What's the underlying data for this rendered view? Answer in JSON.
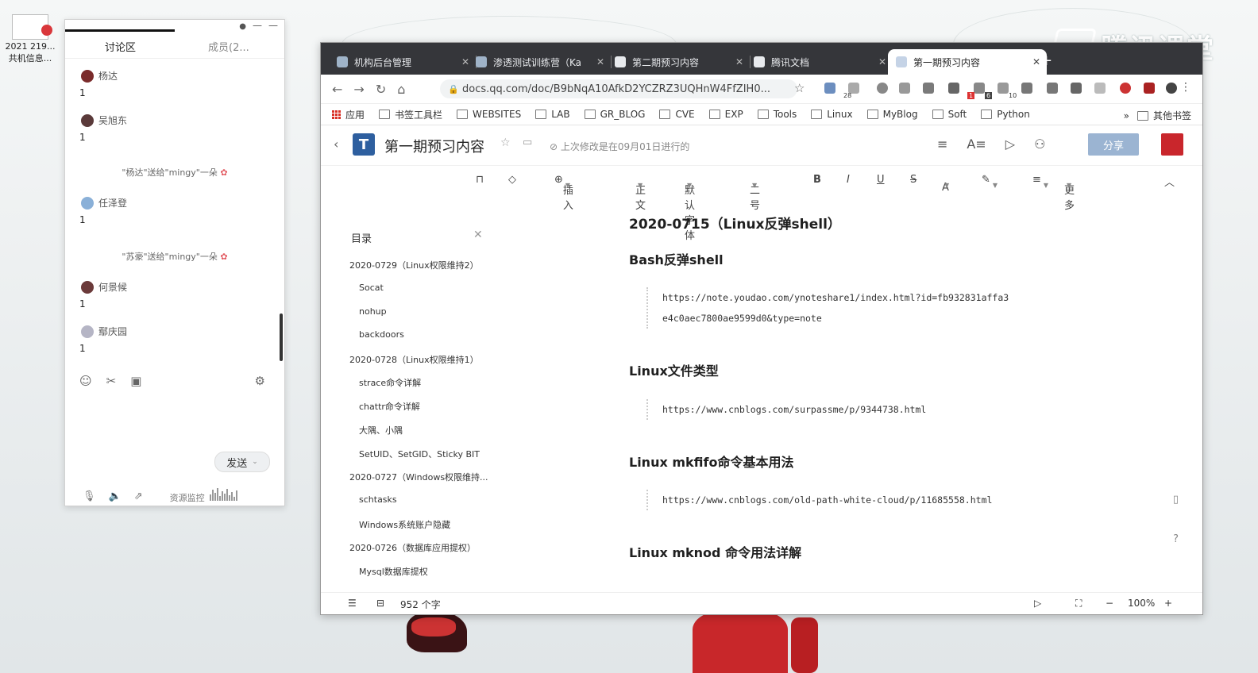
{
  "desktop": {
    "icon_label_1": "2021 219...",
    "icon_label_2": "共机信息...",
    "brand_text": "腾讯课堂"
  },
  "chat": {
    "tab_discussion": "讨论区",
    "tab_members": "成员(2...",
    "messages": [
      {
        "name": "杨达",
        "text": "1"
      },
      {
        "name": "吴旭东",
        "text": "1"
      },
      {
        "name": "任泽登",
        "text": "1"
      },
      {
        "name": "何景候",
        "text": "1"
      },
      {
        "name": "鄢庆园",
        "text": "1"
      }
    ],
    "gifts": [
      "\"杨达\"送给\"mingy\"一朵",
      "\"苏豪\"送给\"mingy\"一朵"
    ],
    "send_label": "发送",
    "monitor_label": "资源监控"
  },
  "browser": {
    "tabs": [
      {
        "label": "机构后台管理"
      },
      {
        "label": "渗透测试训练营（Ka"
      },
      {
        "label": "第二期预习内容"
      },
      {
        "label": "腾讯文档"
      },
      {
        "label": "第一期预习内容"
      }
    ],
    "url": "docs.qq.com/doc/B9bNqA10AfkD2YCZRZ3UQHnW4FfZIH0...",
    "badges": [
      "28",
      "1",
      "6",
      "10"
    ],
    "bookmarks": [
      "应用",
      "书签工具栏",
      "WEBSITES",
      "LAB",
      "GR_BLOG",
      "CVE",
      "EXP",
      "Tools",
      "Linux",
      "MyBlog",
      "Soft",
      "Python"
    ],
    "bookmarks_more": "»",
    "other_bookmarks": "其他书签"
  },
  "doc": {
    "title": "第一期预习内容",
    "saved_status": "上次修改是在09月01日进行的",
    "share_label": "分享",
    "toolbar": {
      "insert": "插入",
      "style": "正文",
      "font": "默认字体",
      "size": "二号",
      "bold": "B",
      "italic": "I",
      "underline": "U",
      "strike": "S",
      "color": "A",
      "more": "更多"
    },
    "outline": {
      "header": "目录",
      "items": [
        "2020-0729（Linux权限维持2）",
        "Socat",
        "nohup",
        "backdoors",
        "2020-0728（Linux权限维持1）",
        "strace命令详解",
        "chattr命令详解",
        "大隅、小隅",
        "SetUID、SetGID、Sticky BIT",
        "2020-0727（Windows权限维持...",
        "schtasks",
        "Windows系统账户隐藏",
        "2020-0726（数据库应用提权）",
        "Mysql数据库提权"
      ]
    },
    "content": {
      "h1": "2020-0715（Linux反弹shell）",
      "sec1": "Bash反弹shell",
      "link1a": "https://note.youdao.com/ynoteshare1/index.html?id=fb932831affa3",
      "link1b": "e4c0aec7800ae9599d0&type=note",
      "sec2": "Linux文件类型",
      "link2": "https://www.cnblogs.com/surpassme/p/9344738.html",
      "sec3": "Linux mkfifo命令基本用法",
      "link3": "https://www.cnblogs.com/old-path-white-cloud/p/11685558.html",
      "sec4": "Linux mknod 命令用法详解"
    },
    "status": {
      "word_count": "952 个字",
      "zoom": "100%"
    }
  }
}
